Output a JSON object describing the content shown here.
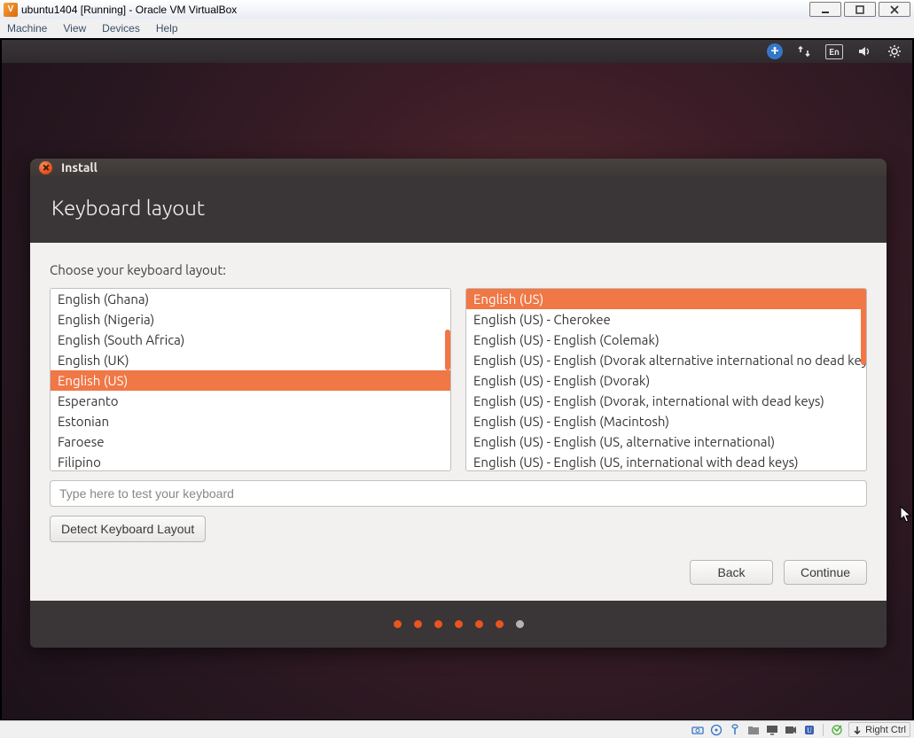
{
  "host": {
    "window_title": "ubuntu1404 [Running] - Oracle VM VirtualBox",
    "menu": {
      "machine": "Machine",
      "view": "View",
      "devices": "Devices",
      "help": "Help"
    },
    "status": {
      "hostkey": "Right Ctrl"
    }
  },
  "panel": {
    "lang_indicator": "En"
  },
  "installer": {
    "window_title": "Install",
    "heading": "Keyboard layout",
    "choose_label": "Choose your keyboard layout:",
    "layouts": [
      "English (Ghana)",
      "English (Nigeria)",
      "English (South Africa)",
      "English (UK)",
      "English (US)",
      "Esperanto",
      "Estonian",
      "Faroese",
      "Filipino"
    ],
    "layouts_selected_index": 4,
    "variants": [
      "English (US)",
      "English (US) - Cherokee",
      "English (US) - English (Colemak)",
      "English (US) - English (Dvorak alternative international no dead keys)",
      "English (US) - English (Dvorak)",
      "English (US) - English (Dvorak, international with dead keys)",
      "English (US) - English (Macintosh)",
      "English (US) - English (US, alternative international)",
      "English (US) - English (US, international with dead keys)"
    ],
    "variants_selected_index": 0,
    "test_placeholder": "Type here to test your keyboard",
    "detect_label": "Detect Keyboard Layout",
    "back_label": "Back",
    "continue_label": "Continue",
    "progress_total": 7,
    "progress_current": 7
  },
  "colors": {
    "ubuntu_orange": "#e95420",
    "selection_orange": "#f07746",
    "installer_bg_dark": "#3a3536",
    "installer_bg_light": "#f2f1f0"
  }
}
